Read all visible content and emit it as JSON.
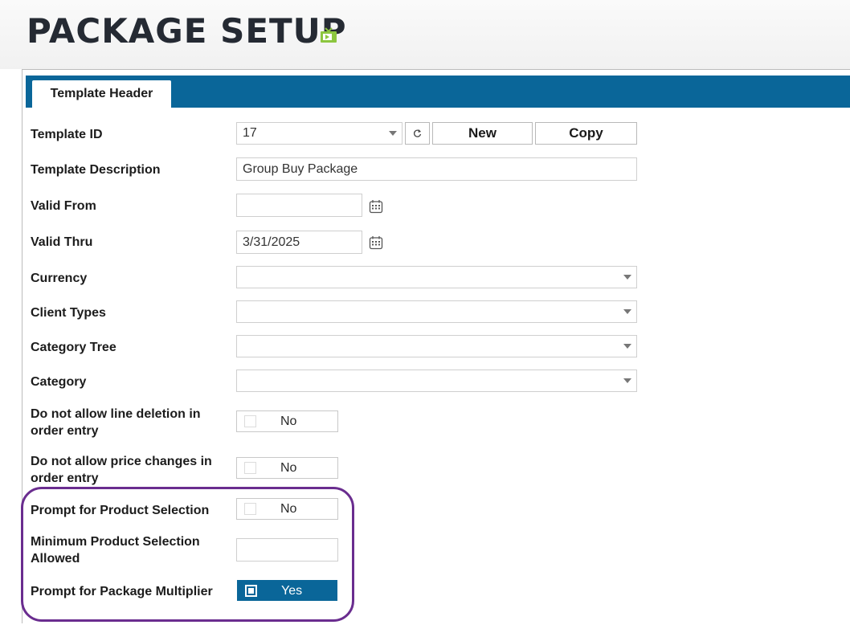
{
  "page": {
    "title": "PACKAGE SETUP",
    "title_icon": "tv-icon"
  },
  "tabs": [
    {
      "label": "Template Header",
      "active": true
    }
  ],
  "form": {
    "template_id": {
      "label": "Template ID",
      "value": "17",
      "new_label": "New",
      "copy_label": "Copy",
      "refresh_icon": "refresh-icon"
    },
    "template_description": {
      "label": "Template Description",
      "value": "Group Buy Package"
    },
    "valid_from": {
      "label": "Valid From",
      "value": "",
      "icon": "calendar-icon"
    },
    "valid_thru": {
      "label": "Valid Thru",
      "value": "3/31/2025",
      "icon": "calendar-icon"
    },
    "currency": {
      "label": "Currency",
      "value": ""
    },
    "client_types": {
      "label": "Client Types",
      "value": ""
    },
    "category_tree": {
      "label": "Category Tree",
      "value": ""
    },
    "category": {
      "label": "Category",
      "value": ""
    },
    "no_line_deletion": {
      "label_line1": "Do not allow line deletion in",
      "label_line2": "order entry",
      "value": "No",
      "checked": false
    },
    "no_price_changes": {
      "label_line1": "Do not allow price changes in",
      "label_line2": "order entry",
      "value": "No",
      "checked": false
    },
    "prompt_product_selection": {
      "label": "Prompt for Product Selection",
      "value": "No",
      "checked": false
    },
    "min_product_selection": {
      "label_line1": "Minimum Product Selection",
      "label_line2": "Allowed",
      "value": ""
    },
    "prompt_package_multiplier": {
      "label": "Prompt for Package Multiplier",
      "value": "Yes",
      "checked": true
    }
  },
  "colors": {
    "accent": "#0a6699",
    "highlight": "#6a2d8f",
    "icon_green": "#8cc63f"
  }
}
